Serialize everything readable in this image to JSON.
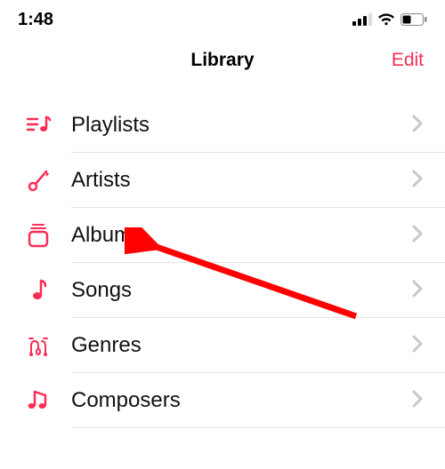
{
  "status": {
    "time": "1:48"
  },
  "header": {
    "title": "Library",
    "edit": "Edit"
  },
  "rows": {
    "playlists": {
      "label": "Playlists"
    },
    "artists": {
      "label": "Artists"
    },
    "albums": {
      "label": "Albums"
    },
    "songs": {
      "label": "Songs"
    },
    "genres": {
      "label": "Genres"
    },
    "composers": {
      "label": "Composers"
    }
  },
  "colors": {
    "accent": "#ff2d55"
  }
}
